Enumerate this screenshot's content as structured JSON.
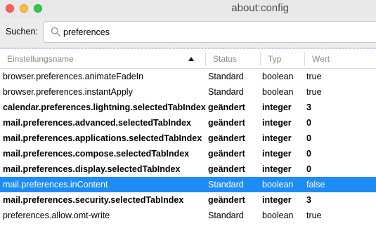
{
  "window": {
    "title": "about:config"
  },
  "search": {
    "label": "Suchen:",
    "value": "preferences"
  },
  "columns": [
    "Einstellungsname",
    "Status",
    "Typ",
    "Wert"
  ],
  "rows": [
    {
      "name": "browser.preferences.animateFadeIn",
      "status": "Standard",
      "type": "boolean",
      "value": "true"
    },
    {
      "name": "browser.preferences.instantApply",
      "status": "Standard",
      "type": "boolean",
      "value": "true"
    },
    {
      "name": "calendar.preferences.lightning.selectedTabIndex",
      "status": "geändert",
      "type": "integer",
      "value": "3"
    },
    {
      "name": "mail.preferences.advanced.selectedTabIndex",
      "status": "geändert",
      "type": "integer",
      "value": "0"
    },
    {
      "name": "mail.preferences.applications.selectedTabIndex",
      "status": "geändert",
      "type": "integer",
      "value": "0"
    },
    {
      "name": "mail.preferences.compose.selectedTabIndex",
      "status": "geändert",
      "type": "integer",
      "value": "0"
    },
    {
      "name": "mail.preferences.display.selectedTabIndex",
      "status": "geändert",
      "type": "integer",
      "value": "0"
    },
    {
      "name": "mail.preferences.inContent",
      "status": "Standard",
      "type": "boolean",
      "value": "false"
    },
    {
      "name": "mail.preferences.security.selectedTabIndex",
      "status": "geändert",
      "type": "integer",
      "value": "3"
    },
    {
      "name": "preferences.allow.omt-write",
      "status": "Standard",
      "type": "boolean",
      "value": "true"
    }
  ],
  "colors": {
    "selection": "#1e8cf7",
    "close": "#fc605b",
    "minimize": "#fdbc40",
    "maximize": "#34c84a"
  }
}
